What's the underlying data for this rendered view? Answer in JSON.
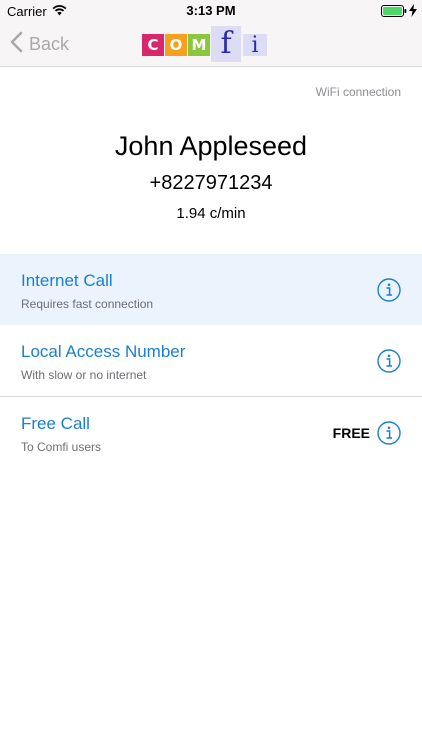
{
  "status_bar": {
    "carrier": "Carrier",
    "time": "3:13 PM"
  },
  "nav": {
    "back_label": "Back",
    "logo_letters": [
      "C",
      "O",
      "M",
      "f",
      "i"
    ],
    "logo_colors": [
      "#d6286b",
      "#f6a11e",
      "#8cc63f",
      "#2b2aa8",
      "#2b2aa8"
    ]
  },
  "contact": {
    "connection": "WiFi connection",
    "name": "John Appleseed",
    "number": "+8227971234",
    "rate": "1.94 c/min"
  },
  "options": [
    {
      "title": "Internet Call",
      "subtitle": "Requires fast connection",
      "badge": "",
      "selected": true
    },
    {
      "title": "Local Access Number",
      "subtitle": "With slow or no internet",
      "badge": "",
      "selected": false
    },
    {
      "title": "Free Call",
      "subtitle": "To Comfi users",
      "badge": "FREE",
      "selected": false
    }
  ],
  "accent_color": "#1a7fd1"
}
